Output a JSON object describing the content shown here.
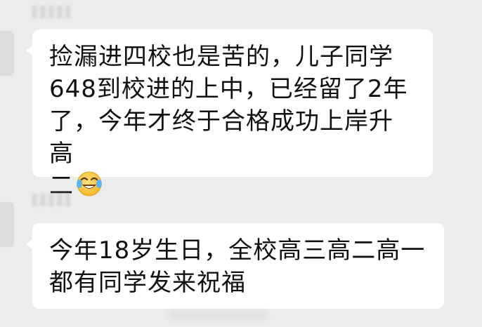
{
  "chat": {
    "messages": [
      {
        "text": "捡漏进四校也是苦的，儿子同学\n648到校进的上中，已经留了2年\n了，今年才终于合格成功上岸升高\n二",
        "emoji": "face-with-tears-of-joy"
      },
      {
        "text": "今年18岁生日，全校高三高二高一\n都有同学发来祝福"
      }
    ]
  },
  "colors": {
    "background": "#ececec",
    "bubble": "#ffffff",
    "text": "#111111"
  }
}
